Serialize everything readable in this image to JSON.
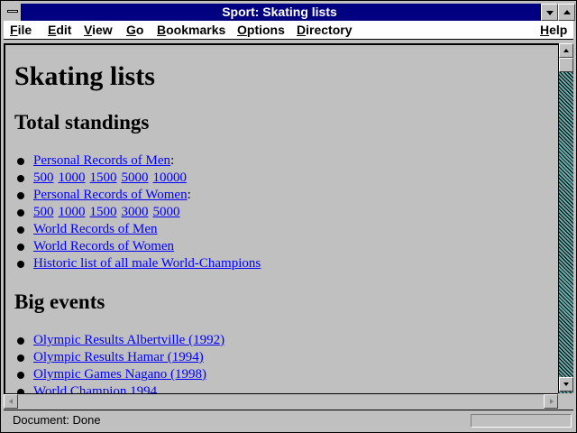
{
  "window": {
    "title": "Sport: Skating lists"
  },
  "menubar": {
    "items": [
      {
        "first": "F",
        "rest": "ile"
      },
      {
        "first": "E",
        "rest": "dit"
      },
      {
        "first": "V",
        "rest": "iew"
      },
      {
        "first": "G",
        "rest": "o"
      },
      {
        "first": "B",
        "rest": "ookmarks"
      },
      {
        "first": "O",
        "rest": "ptions"
      },
      {
        "first": "D",
        "rest": "irectory"
      },
      {
        "first": "H",
        "rest": "elp"
      }
    ]
  },
  "page": {
    "heading": "Skating lists",
    "section1": {
      "heading": "Total standings",
      "items": [
        {
          "links": [
            "Personal Records of Men"
          ],
          "suffix": ":"
        },
        {
          "links": [
            "500",
            "1000",
            "1500",
            "5000",
            "10000"
          ],
          "suffix": ""
        },
        {
          "links": [
            "Personal Records of Women"
          ],
          "suffix": ":"
        },
        {
          "links": [
            "500",
            "1000",
            "1500",
            "3000",
            "5000"
          ],
          "suffix": ""
        },
        {
          "links": [
            "World Records of Men"
          ],
          "suffix": ""
        },
        {
          "links": [
            "World Records of Women"
          ],
          "suffix": ""
        },
        {
          "links": [
            "Historic list of all male World-Champions"
          ],
          "suffix": ""
        }
      ]
    },
    "section2": {
      "heading": "Big events",
      "items": [
        {
          "links": [
            "Olympic Results Albertville (1992)"
          ],
          "suffix": ""
        },
        {
          "links": [
            "Olympic Results Hamar (1994)"
          ],
          "suffix": ""
        },
        {
          "links": [
            "Olympic Games Nagano (1998)"
          ],
          "suffix": ""
        },
        {
          "links": [
            "World Champion 1994"
          ],
          "suffix": ""
        }
      ]
    }
  },
  "status": {
    "text": "Document: Done"
  },
  "colors": {
    "titlebar": "#000080",
    "link": "#0000ff",
    "background": "#c0c0c0"
  }
}
